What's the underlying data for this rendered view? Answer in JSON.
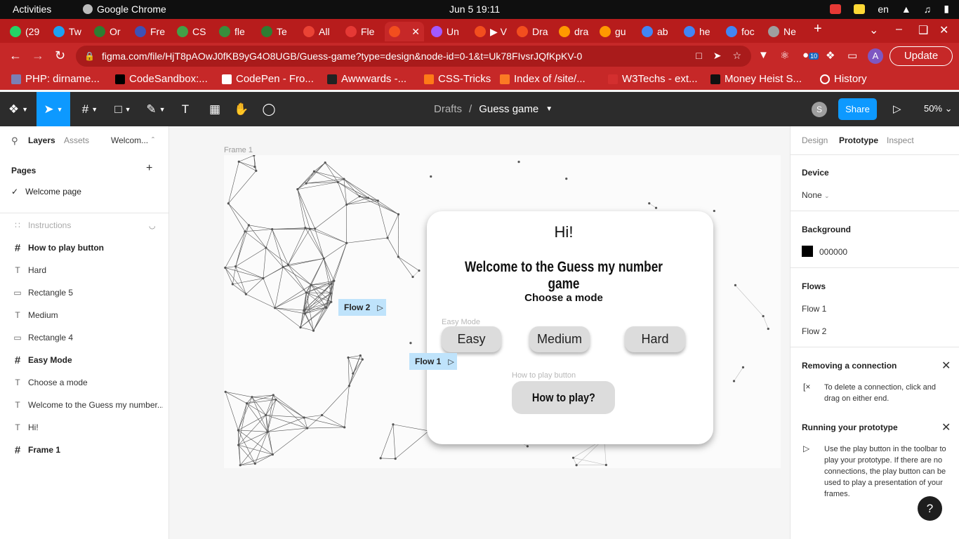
{
  "system": {
    "activities": "Activities",
    "app_name": "Google Chrome",
    "clock": "Jun 5  19:11",
    "language": "en"
  },
  "browser": {
    "tabs": [
      {
        "label": "(29",
        "icon_color": "#25d366"
      },
      {
        "label": "Tw",
        "icon_color": "#1da1f2"
      },
      {
        "label": "Or",
        "icon_color": "#2e7d32"
      },
      {
        "label": "Fre",
        "icon_color": "#3f51b5"
      },
      {
        "label": "CS",
        "icon_color": "#43a047"
      },
      {
        "label": "fle",
        "icon_color": "#388e3c"
      },
      {
        "label": "Te",
        "icon_color": "#2e7d32"
      },
      {
        "label": "All",
        "icon_color": "#ea4335"
      },
      {
        "label": "Fle",
        "icon_color": "#e53935"
      },
      {
        "label": "",
        "icon_color": "#f24e1e"
      },
      {
        "label": "Un",
        "icon_color": "#a259ff"
      },
      {
        "label": "▶ V",
        "icon_color": "#f24e1e"
      },
      {
        "label": "Dra",
        "icon_color": "#f24e1e"
      },
      {
        "label": "dra",
        "icon_color": "#ff9800"
      },
      {
        "label": "gu",
        "icon_color": "#ff9800"
      },
      {
        "label": "ab",
        "icon_color": "#4285f4"
      },
      {
        "label": "he",
        "icon_color": "#4285f4"
      },
      {
        "label": "foc",
        "icon_color": "#4285f4"
      },
      {
        "label": "Ne",
        "icon_color": "#9e9e9e"
      }
    ],
    "url": "figma.com/file/HjT8pAOwJ0fKB9yG4O8UGB/Guess-game?type=design&node-id=0-1&t=Uk78FIvsrJQfKpKV-0",
    "update_label": "Update",
    "profile_initial": "A",
    "extension_badge": "10",
    "bookmarks": [
      {
        "label": "PHP: dirname...",
        "icon_color": "#7b7fb5"
      },
      {
        "label": "CodeSandbox:...",
        "icon_color": "#000000"
      },
      {
        "label": "CodePen - Fro...",
        "icon_color": "#ffffff"
      },
      {
        "label": "Awwwards -...",
        "icon_color": "#222222"
      },
      {
        "label": "CSS-Tricks",
        "icon_color": "#ff7a18"
      },
      {
        "label": "Index of /site/...",
        "icon_color": "#fb7a24"
      },
      {
        "label": "W3Techs - ext...",
        "icon_color": "#d32f2f"
      },
      {
        "label": "Money Heist S...",
        "icon_color": "#111111"
      },
      {
        "label": "History",
        "icon_color": "#ffffff"
      }
    ]
  },
  "figma": {
    "breadcrumb_drafts": "Drafts",
    "breadcrumb_sep": "/",
    "file_name": "Guess game",
    "user_initial": "S",
    "share_label": "Share",
    "zoom": "50%",
    "accent": "#0d99ff"
  },
  "left_panel": {
    "tabs": [
      "Layers",
      "Assets",
      "Welcom..."
    ],
    "pages_title": "Pages",
    "pages": [
      "Welcome page"
    ],
    "layers": [
      {
        "name": "Instructions",
        "kind": "group",
        "hidden": true
      },
      {
        "name": "How to play button",
        "kind": "frame"
      },
      {
        "name": "Hard",
        "kind": "text"
      },
      {
        "name": "Rectangle 5",
        "kind": "rect"
      },
      {
        "name": "Medium",
        "kind": "text"
      },
      {
        "name": "Rectangle 4",
        "kind": "rect"
      },
      {
        "name": "Easy Mode",
        "kind": "frame"
      },
      {
        "name": "Choose a mode",
        "kind": "text"
      },
      {
        "name": "Welcome to the Guess my number...",
        "kind": "text"
      },
      {
        "name": "Hi!",
        "kind": "text"
      },
      {
        "name": "Frame 1",
        "kind": "frame"
      }
    ]
  },
  "canvas": {
    "frame_label": "Frame 1",
    "hi": "Hi!",
    "welcome": "Welcome to the Guess my number game",
    "choose": "Choose a mode",
    "easy_mode_label": "Easy Mode",
    "easy": "Easy",
    "medium": "Medium",
    "hard": "Hard",
    "how_label": "How to play button",
    "how": "How to play?",
    "flow1": "Flow 1",
    "flow2": "Flow 2"
  },
  "right_panel": {
    "tabs": [
      "Design",
      "Prototype",
      "Inspect"
    ],
    "device_title": "Device",
    "device_value": "None",
    "background_title": "Background",
    "background_value": "000000",
    "flows_title": "Flows",
    "flows": [
      "Flow 1",
      "Flow 2"
    ],
    "removing_title": "Removing a connection",
    "removing_text": "To delete a connection, click and drag on either end.",
    "running_title": "Running your prototype",
    "running_text": "Use the play button in the toolbar to play your prototype. If there are no connections, the play button can be used to play a presentation of your frames.",
    "help": "?"
  }
}
